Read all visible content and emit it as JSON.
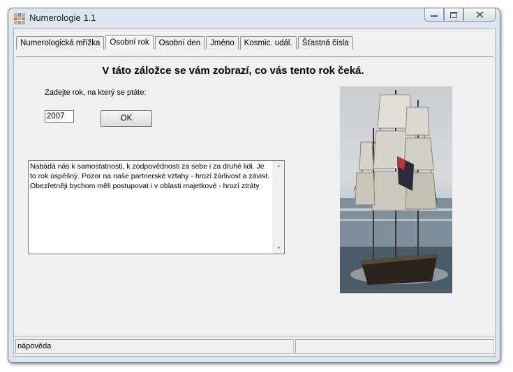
{
  "window": {
    "title": "Numerologie 1.1"
  },
  "tabs": [
    {
      "label": "Numerologická mřížka",
      "active": false
    },
    {
      "label": "Osobní rok",
      "active": true
    },
    {
      "label": "Osobní den",
      "active": false
    },
    {
      "label": "Jméno",
      "active": false
    },
    {
      "label": "Kosmic. udál.",
      "active": false
    },
    {
      "label": "Šťastná čísla",
      "active": false
    }
  ],
  "main": {
    "heading": "V táto záložce se vám zobrazí, co vás tento rok čeká.",
    "year_label": "Zadejte rok, na který se ptáte:",
    "year_value": "2007",
    "ok_label": "OK",
    "result_text": "Nabádá nás k samostatnosti, k zodpovědnosti za sebe i za druhé lidi. Je to rok úspěšný. Pozor na naše partnerské vztahy - hrozí žárlivost a závist. Obezřetněji bychom měli postupovat i v oblasti majetkové - hrozí ztráty"
  },
  "status": {
    "hint": "nápověda",
    "right": ""
  },
  "icons": {
    "app": "app-grid-icon",
    "minimize": "minimize-icon",
    "maximize": "maximize-icon",
    "close": "close-icon",
    "scroll_up": "arrow-up-icon",
    "scroll_down": "arrow-down-icon"
  }
}
